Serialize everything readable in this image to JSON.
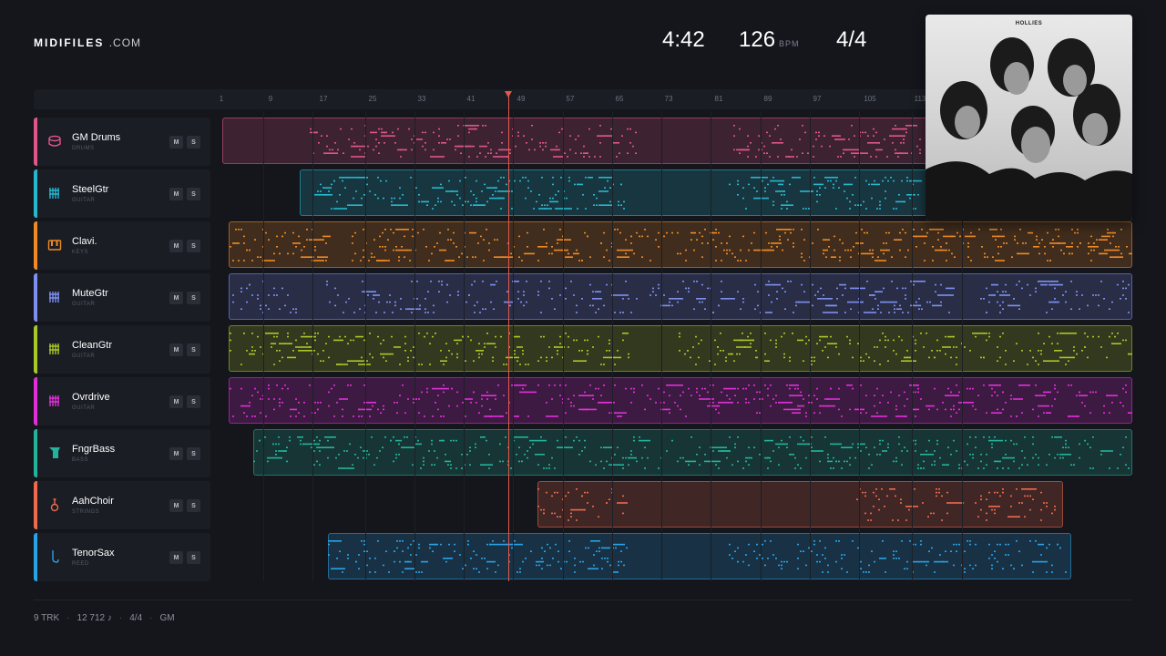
{
  "brand": {
    "name": "MIDIFILES",
    "suffix": ".COM"
  },
  "transport": {
    "time": "4:42",
    "tempo": "126",
    "tempo_unit": "BPM",
    "signature": "4/4"
  },
  "cover": {
    "band": "HOLLIES"
  },
  "ruler": {
    "labels": [
      "1",
      "9",
      "17",
      "25",
      "33",
      "41",
      "49",
      "57",
      "65",
      "73",
      "81",
      "89",
      "97",
      "105",
      "113"
    ]
  },
  "tracks": [
    {
      "name": "GM Drums",
      "kind": "DRUMS",
      "color": "#e0558a",
      "icon": "drum-icon",
      "mute": "M",
      "solo": "S"
    },
    {
      "name": "SteelGtr",
      "kind": "GUITAR",
      "color": "#26b7cf",
      "icon": "guitar-icon",
      "mute": "M",
      "solo": "S"
    },
    {
      "name": "Clavi.",
      "kind": "KEYS",
      "color": "#f08a24",
      "icon": "keys-icon",
      "mute": "M",
      "solo": "S"
    },
    {
      "name": "MuteGtr",
      "kind": "GUITAR",
      "color": "#7f8ff0",
      "icon": "guitar-icon",
      "mute": "M",
      "solo": "S"
    },
    {
      "name": "CleanGtr",
      "kind": "GUITAR",
      "color": "#a9c728",
      "icon": "guitar-icon",
      "mute": "M",
      "solo": "S"
    },
    {
      "name": "Ovrdrive",
      "kind": "GUITAR",
      "color": "#e02fd8",
      "icon": "guitar-icon",
      "mute": "M",
      "solo": "S"
    },
    {
      "name": "FngrBass",
      "kind": "BASS",
      "color": "#22b39a",
      "icon": "bass-icon",
      "mute": "M",
      "solo": "S"
    },
    {
      "name": "AahChoir",
      "kind": "STRINGS",
      "color": "#ef6a4c",
      "icon": "violin-icon",
      "mute": "M",
      "solo": "S"
    },
    {
      "name": "TenorSax",
      "kind": "REED",
      "color": "#2aa2e6",
      "icon": "sax-icon",
      "mute": "M",
      "solo": "S"
    }
  ],
  "footer": {
    "tracks": "9 TRK",
    "notes": "12 712 ♪",
    "signature": "4/4",
    "standard": "GM"
  }
}
